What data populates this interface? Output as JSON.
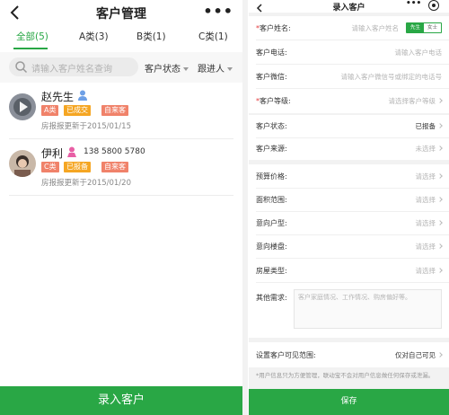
{
  "left": {
    "title": "客户管理",
    "more": "•••",
    "tabs": [
      "全部(5)",
      "A类(3)",
      "B类(1)",
      "C类(1)"
    ],
    "search_placeholder": "请输入客户姓名查询",
    "filter_status": "客户状态",
    "filter_follower": "跟进人",
    "customers": [
      {
        "name": "赵先生",
        "gender": "male",
        "phone": "",
        "badges": [
          "A类",
          "已成交",
          "自来客"
        ],
        "date": "房报报更新于2015/01/15"
      },
      {
        "name": "伊利",
        "gender": "female",
        "phone": "138 5800 5780",
        "badges": [
          "C类",
          "已报备",
          "自来客"
        ],
        "date": "房报报更新于2015/01/20"
      }
    ],
    "footer_button": "录入客户"
  },
  "right": {
    "title": "录入客户",
    "more": "•••",
    "fields": {
      "name_label": "客户姓名:",
      "name_placeholder": "请输入客户姓名",
      "gender_on": "先生",
      "gender_off": "女士",
      "phone_label": "客户电话:",
      "phone_placeholder": "请输入客户电话",
      "wechat_label": "客户微信:",
      "wechat_placeholder": "请输入客户微信号或绑定的电话号",
      "level_label": "客户等级:",
      "level_placeholder": "请选择客户等级",
      "status_label": "客户状态:",
      "status_value": "已报备",
      "source_label": "客户来源:",
      "source_value": "未选择",
      "budget_label": "预算价格:",
      "budget_value": "请选择",
      "area_label": "面积范围:",
      "area_value": "请选择",
      "layout_label": "意向户型:",
      "layout_value": "请选择",
      "property_label": "意向楼盘:",
      "property_value": "请选择",
      "house_type_label": "房屋类型:",
      "house_type_value": "请选择",
      "other_label": "其他需求:",
      "other_placeholder": "客户家庭情况、工作情况、购房偏好等。",
      "visibility_label": "设置客户可见范围:",
      "visibility_value": "仅对自己可见"
    },
    "note": "*用户信息只为方便管理，联动宝不会对用户信息做任何保存或泄漏。",
    "save_button": "保存"
  },
  "colors": {
    "brand_green": "#29a745",
    "badge_a": "#f0826a",
    "badge_c": "#f0826a",
    "badge_done": "#f5a623",
    "badge_reported": "#f5a623",
    "badge_self": "#f0826a",
    "male_icon": "#6ea0e6",
    "female_icon": "#e85fa5",
    "required": "#e4393c"
  },
  "icons": [
    "back-chevron-icon",
    "more-dots-icon",
    "search-icon",
    "dropdown-caret-icon",
    "male-icon",
    "female-icon",
    "chevron-right-icon",
    "target-icon"
  ]
}
